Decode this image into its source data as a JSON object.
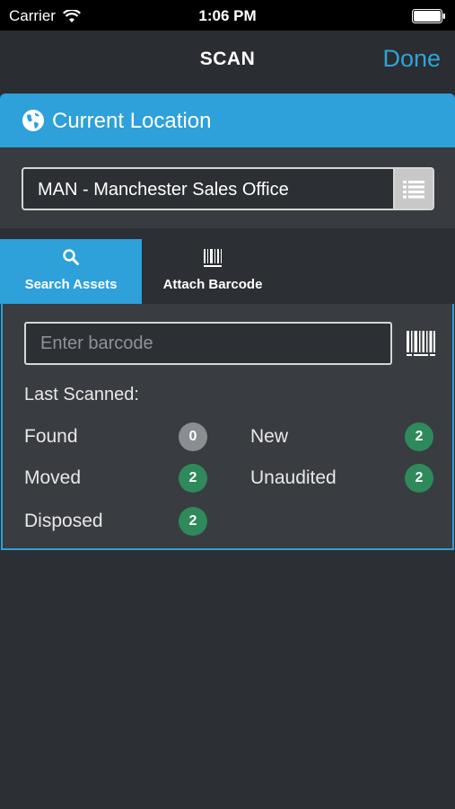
{
  "status_bar": {
    "carrier": "Carrier",
    "time": "1:06 PM"
  },
  "nav": {
    "title": "SCAN",
    "done": "Done"
  },
  "location": {
    "header": "Current Location",
    "selected": "MAN - Manchester Sales Office"
  },
  "tabs": [
    {
      "label": "Search Assets",
      "icon": "search-icon",
      "active": true
    },
    {
      "label": "Attach Barcode",
      "icon": "barcode-icon",
      "active": false
    }
  ],
  "search": {
    "placeholder": "Enter barcode",
    "value": ""
  },
  "last_scanned": {
    "label": "Last Scanned:",
    "stats": [
      {
        "label": "Found",
        "count": "0",
        "color": "#8a8d91"
      },
      {
        "label": "New",
        "count": "2",
        "color": "#2e8a5a"
      },
      {
        "label": "Moved",
        "count": "2",
        "color": "#2e8a5a"
      },
      {
        "label": "Unaudited",
        "count": "2",
        "color": "#2e8a5a"
      },
      {
        "label": "Disposed",
        "count": "2",
        "color": "#2e8a5a"
      }
    ]
  },
  "colors": {
    "accent": "#2ea0da",
    "background": "#2c2f33",
    "badge_green": "#2e8a5a",
    "badge_grey": "#8a8d91"
  }
}
